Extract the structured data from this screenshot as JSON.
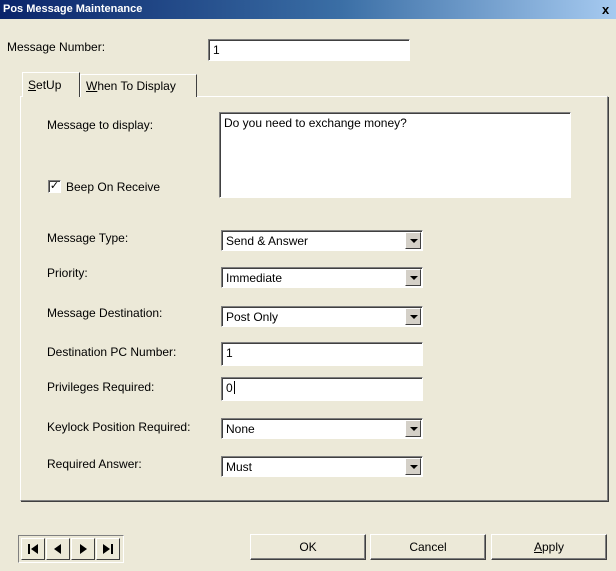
{
  "window": {
    "title": "Pos Message Maintenance",
    "close_glyph": "x"
  },
  "header": {
    "message_number_label": "Message Number:",
    "message_number_value": "1"
  },
  "tabs": [
    {
      "label_first": "S",
      "label_rest": "etUp",
      "active": true
    },
    {
      "label_first": "W",
      "label_rest": "hen To Display",
      "active": false
    }
  ],
  "setup": {
    "message_to_display_label": "Message to display:",
    "message_to_display_value": "Do you need to exchange money?",
    "beep_on_receive_label": "Beep On Receive",
    "beep_on_receive_checked": true,
    "beep_check_glyph": "✓",
    "message_type_label": "Message Type:",
    "message_type_value": "Send & Answer",
    "priority_label": "Priority:",
    "priority_value": "Immediate",
    "message_destination_label": "Message Destination:",
    "message_destination_value": "Post Only",
    "destination_pc_label": "Destination PC Number:",
    "destination_pc_value": "1",
    "privileges_label": "Privileges Required:",
    "privileges_value": "0",
    "keylock_label": "Keylock Position Required:",
    "keylock_value": "None",
    "required_answer_label": "Required Answer:",
    "required_answer_value": "Must"
  },
  "footer": {
    "ok_label": "OK",
    "cancel_label": "Cancel",
    "apply_label_first": "A",
    "apply_label_rest": "pply"
  },
  "icons": {
    "first": "first-record-icon",
    "prev": "previous-record-icon",
    "next": "next-record-icon",
    "last": "last-record-icon"
  }
}
